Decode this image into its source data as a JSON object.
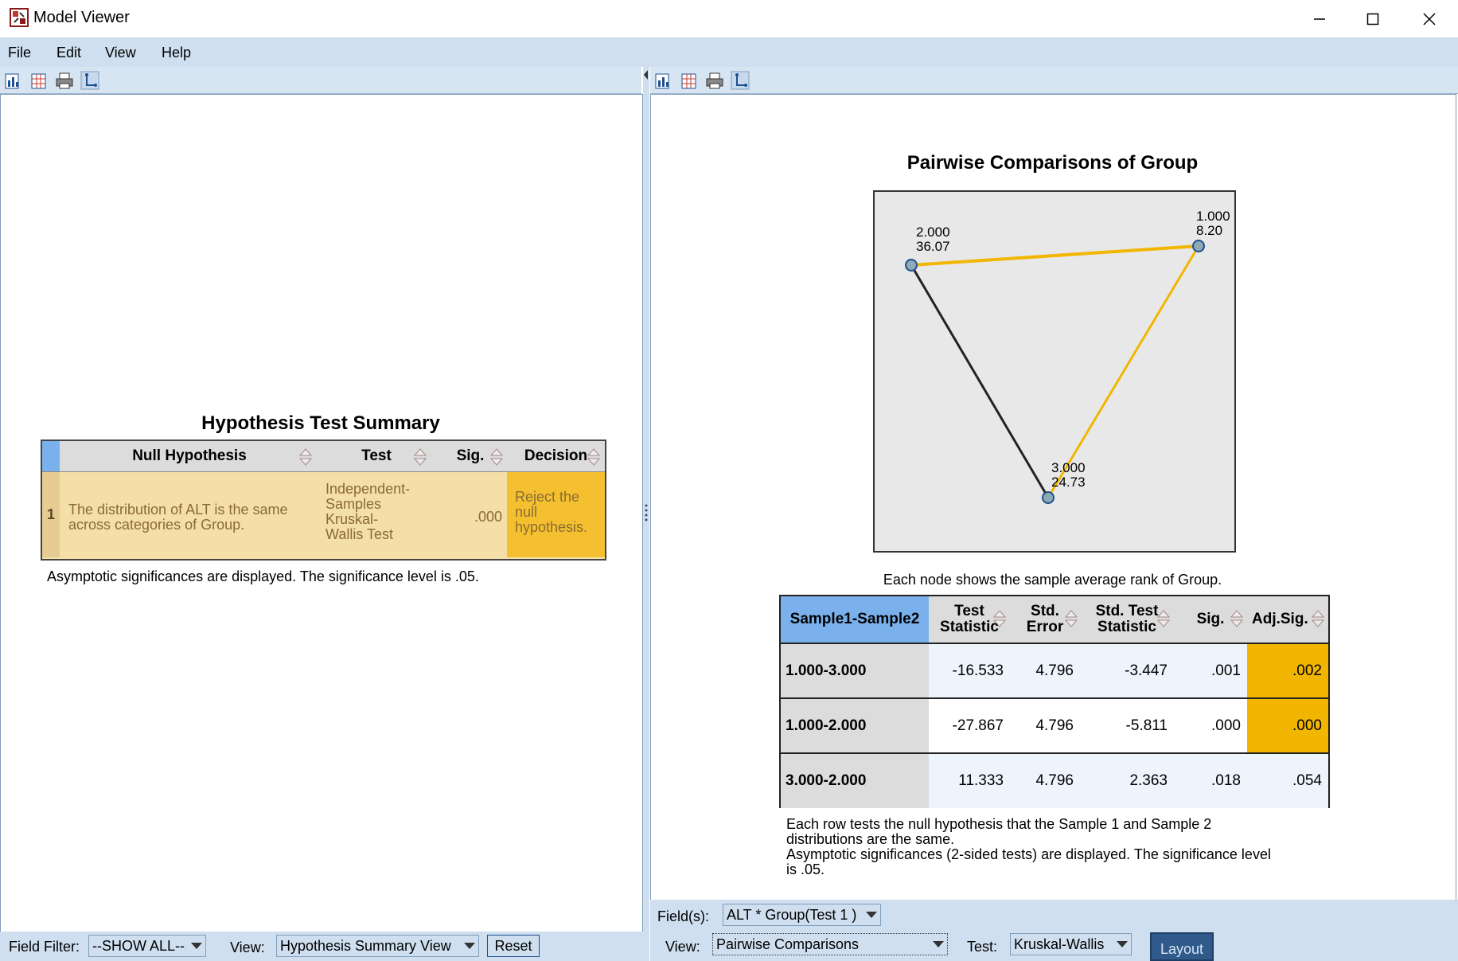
{
  "window": {
    "title": "Model Viewer"
  },
  "menu": {
    "file": "File",
    "edit": "Edit",
    "view": "View",
    "help": "Help"
  },
  "left": {
    "hypothesis": {
      "title": "Hypothesis Test Summary",
      "headers": {
        "null": "Null Hypothesis",
        "test": "Test",
        "sig": "Sig.",
        "decision": "Decision"
      },
      "row": {
        "num": "1",
        "null1": "The distribution of ALT is the same",
        "null2": "across categories of Group.",
        "test1": "Independent-",
        "test2": "Samples",
        "test3": "Kruskal-",
        "test4": "Wallis Test",
        "sig": ".000",
        "dec1": "Reject the",
        "dec2": "null",
        "dec3": "hypothesis."
      },
      "note": "Asymptotic significances are displayed.  The significance level is .05."
    },
    "footer": {
      "field_filter_label": "Field Filter:",
      "field_filter_value": "--SHOW ALL--",
      "view_label": "View:",
      "view_value": "Hypothesis Summary View",
      "reset": "Reset"
    }
  },
  "right": {
    "chart": {
      "title": "Pairwise Comparisons of Group",
      "nodes": [
        {
          "label": "1.000",
          "rank": "8.20"
        },
        {
          "label": "2.000",
          "rank": "36.07"
        },
        {
          "label": "3.000",
          "rank": "24.73"
        }
      ],
      "note": "Each node shows the sample average rank of Group."
    },
    "pairwise": {
      "headers": {
        "pair": "Sample1-Sample2",
        "ts1": "Test",
        "ts2": "Statistic",
        "se1": "Std.",
        "se2": "Error",
        "sts1": "Std. Test",
        "sts2": "Statistic",
        "sig": "Sig.",
        "adj": "Adj.Sig."
      },
      "rows": [
        {
          "pair": "1.000-3.000",
          "ts": "-16.533",
          "se": "4.796",
          "sts": "-3.447",
          "sig": ".001",
          "adj": ".002"
        },
        {
          "pair": "1.000-2.000",
          "ts": "-27.867",
          "se": "4.796",
          "sts": "-5.811",
          "sig": ".000",
          "adj": ".000"
        },
        {
          "pair": "3.000-2.000",
          "ts": "11.333",
          "se": "4.796",
          "sts": "2.363",
          "sig": ".018",
          "adj": ".054"
        }
      ],
      "note1": "Each row tests the null hypothesis that the Sample 1 and Sample 2",
      "note2": "distributions are the same.",
      "note3": "Asymptotic significances (2-sided tests) are displayed. The significance level",
      "note4": "is .05."
    },
    "footer": {
      "fields_label": "Field(s):",
      "fields_value": "ALT * Group(Test 1 )",
      "view_label": "View:",
      "view_value": "Pairwise Comparisons",
      "test_label": "Test:",
      "test_value": "Kruskal-Wallis",
      "layout": "Layout"
    }
  },
  "colors": {
    "significant": "#f2b600",
    "blue_header": "#7ab1ec",
    "decision": "#f5c030"
  }
}
